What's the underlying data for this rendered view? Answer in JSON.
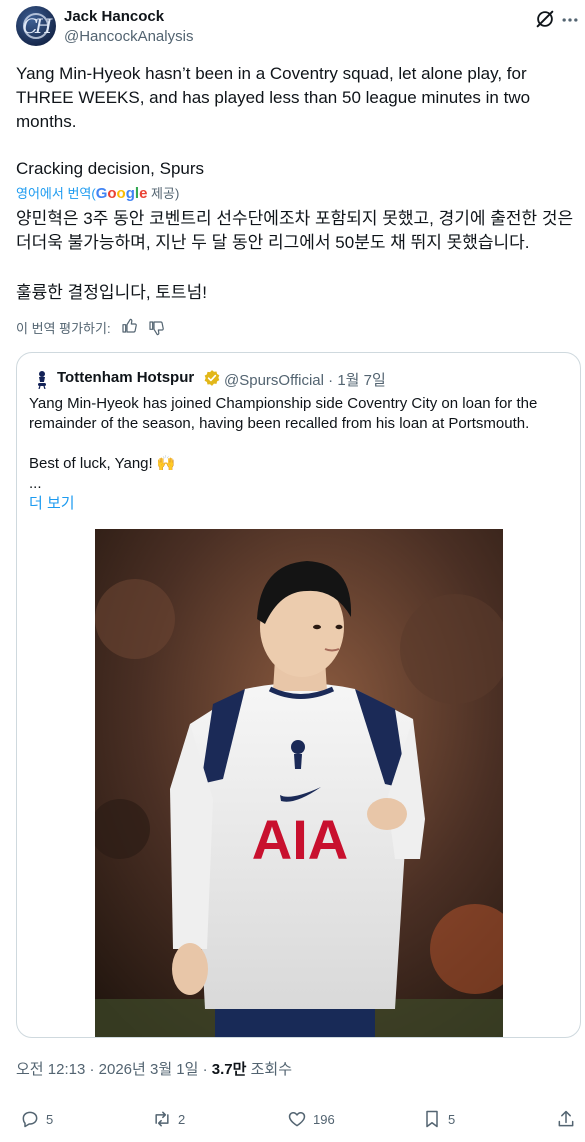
{
  "author": {
    "name": "Jack Hancock",
    "handle": "@HancockAnalysis",
    "avatar_text": "CH"
  },
  "tweet": {
    "text_en": "Yang Min-Hyeok hasn’t been in a Coventry squad, let alone play, for THREE WEEKS, and has played less than 50 league minutes in two months.",
    "text_en2": "Cracking decision, Spurs",
    "translate_prefix": "영어에서 번역(",
    "translate_google": "Google",
    "translate_suffix": " 제공)",
    "text_ko": "양민혁은 3주 동안 코벤트리 선수단에조차 포함되지 못했고, 경기에 출전한 것은 더더욱 불가능하며, 지난 두 달 동안 리그에서 50분도 채 뛰지 못했습니다.",
    "text_ko2": "훌륭한 결정입니다, 토트넘!",
    "rate_label": "이 번역 평가하기:"
  },
  "quote": {
    "author": "Tottenham Hotspur",
    "handle": "@SpursOfficial",
    "date": "1월 7일",
    "text": "Yang Min-Hyeok has joined Championship side Coventry City on loan for the remainder of the season, having been recalled from his loan at Portsmouth.",
    "text2": "Best of luck, Yang! 🙌",
    "ellipsis": "...",
    "show_more": "더 보기",
    "photo": {
      "sponsor": "AIA"
    }
  },
  "meta": {
    "time": "오전 12:13",
    "date": "2026년 3월 1일",
    "views": "3.7만",
    "views_label": "조회수"
  },
  "actions": {
    "replies": "5",
    "reposts": "2",
    "likes": "196",
    "bookmarks": "5"
  },
  "colors": {
    "link": "#1d9bf0",
    "secondary_text": "#536471",
    "primary_text": "#0f1419",
    "verified_gold": "#e2b719",
    "border": "#cfd9de"
  },
  "icons": [
    "grok-icon",
    "more-icon",
    "thumbs-up-icon",
    "thumbs-down-icon",
    "verified-icon",
    "reply-icon",
    "repost-icon",
    "like-icon",
    "bookmark-icon",
    "share-icon"
  ]
}
